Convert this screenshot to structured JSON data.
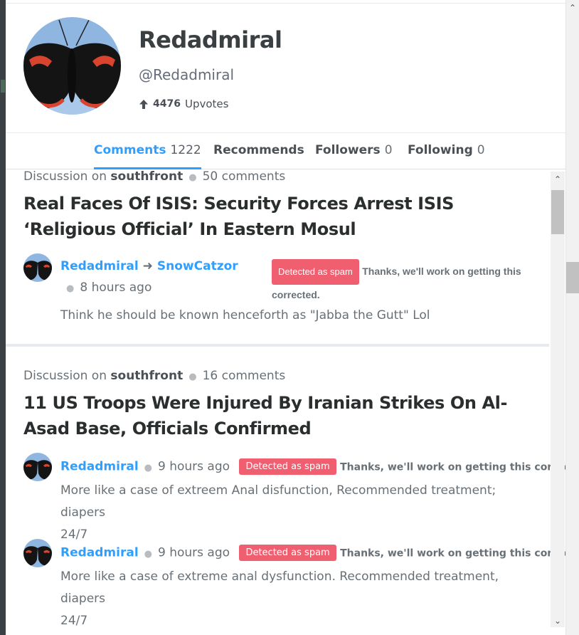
{
  "profile": {
    "username": "Redadmiral",
    "handle": "@Redadmiral",
    "upvote_count": "4476",
    "upvote_label": "Upvotes"
  },
  "tabs": [
    {
      "label": "Comments",
      "count": "1222",
      "active": true
    },
    {
      "label": "Recommends",
      "count": ""
    },
    {
      "label": "Followers",
      "count": "0"
    },
    {
      "label": "Following",
      "count": "0"
    }
  ],
  "posts": [
    {
      "discussion_prefix": "Discussion on",
      "site": "southfront",
      "comments_count": "50 comments",
      "title": "Real Faces Of ISIS: Security Forces Arrest ISIS ‘Religious Official’ In Eastern Mosul",
      "comments": [
        {
          "author": "Redadmiral",
          "reply_to": "SnowCatzor",
          "time": "8 hours ago",
          "spam_badge": "Detected as spam",
          "spam_message": "Thanks, we'll work on getting this corrected.",
          "text": "Think he should be known henceforth as \"Jabba the Gutt\" Lol"
        }
      ]
    },
    {
      "discussion_prefix": "Discussion on",
      "site": "southfront",
      "comments_count": "16 comments",
      "title": "11 US Troops Were Injured By Iranian Strikes On Al-Asad Base, Officials Confirmed",
      "comments": [
        {
          "author": "Redadmiral",
          "time": "9 hours ago",
          "spam_badge": "Detected as spam",
          "spam_message": "Thanks, we'll work on getting this corrected.",
          "text_line1": "More like a case of extreem Anal disfunction, Recommended treatment; diapers",
          "text_line2": "24/7"
        },
        {
          "author": "Redadmiral",
          "time": "9 hours ago",
          "spam_badge": "Detected as spam",
          "spam_message": "Thanks, we'll work on getting this corrected.",
          "text_line1": "More like a case of extreme anal dysfunction. Recommended treatment, diapers",
          "text_line2": "24/7"
        }
      ]
    }
  ],
  "colors": {
    "accent": "#2e9fff",
    "spam_badge": "#f05f70",
    "heading": "#2a2e2e",
    "muted": "#687076"
  },
  "icons": [
    "upvote-arrow-icon",
    "reply-arrow-icon",
    "scroll-up-icon",
    "scroll-down-icon"
  ]
}
